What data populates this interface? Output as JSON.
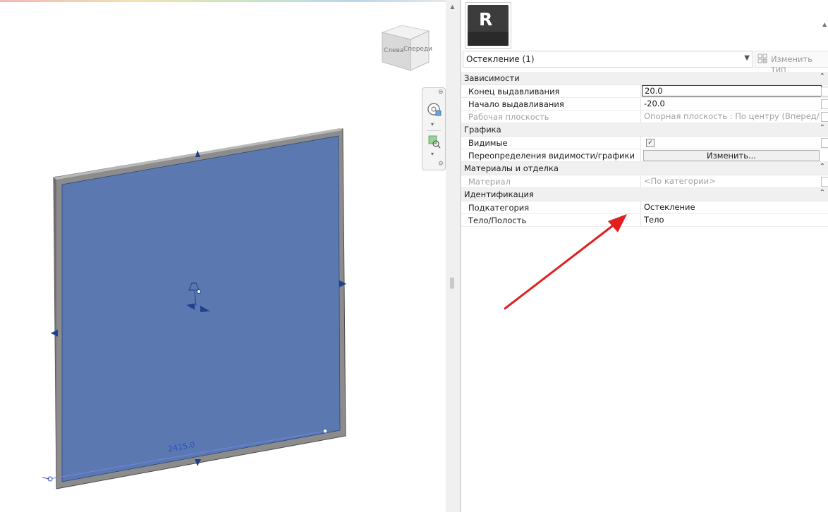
{
  "viewport": {
    "dimension_value": "2415.0",
    "viewcube": {
      "face_left": "Слева",
      "face_front": "Спереди"
    },
    "navbar": {
      "close_icon": "close-icon",
      "steering_wheel_icon": "steering-wheel-icon",
      "zoom_icon": "zoom-icon",
      "options_icon": "gear-icon"
    },
    "glazing_color": "#5b78b0"
  },
  "properties": {
    "type_selector": {
      "value": "Остекление (1)"
    },
    "edit_type_label": "Изменить тип",
    "categories": [
      {
        "name": "Зависимости",
        "rows": [
          {
            "label": "Конец выдавливания",
            "value": "20.0"
          },
          {
            "label": "Начало выдавливания",
            "value": "-20.0"
          },
          {
            "label": "Рабочая плоскость",
            "value": "Опорная плоскость : По центру (Вперед/Н..."
          }
        ]
      },
      {
        "name": "Графика",
        "rows": [
          {
            "label": "Видимые",
            "value": "✓"
          },
          {
            "label": "Переопределения видимости/графики",
            "value": "Изменить..."
          }
        ]
      },
      {
        "name": "Материалы и отделка",
        "rows": [
          {
            "label": "Материал",
            "value": "<По категории>"
          }
        ]
      },
      {
        "name": "Идентификация",
        "rows": [
          {
            "label": "Подкатегория",
            "value": "Остекление"
          },
          {
            "label": "Тело/Полость",
            "value": "Тело"
          }
        ]
      }
    ]
  },
  "annotation": {
    "arrow_color": "#e02020"
  }
}
